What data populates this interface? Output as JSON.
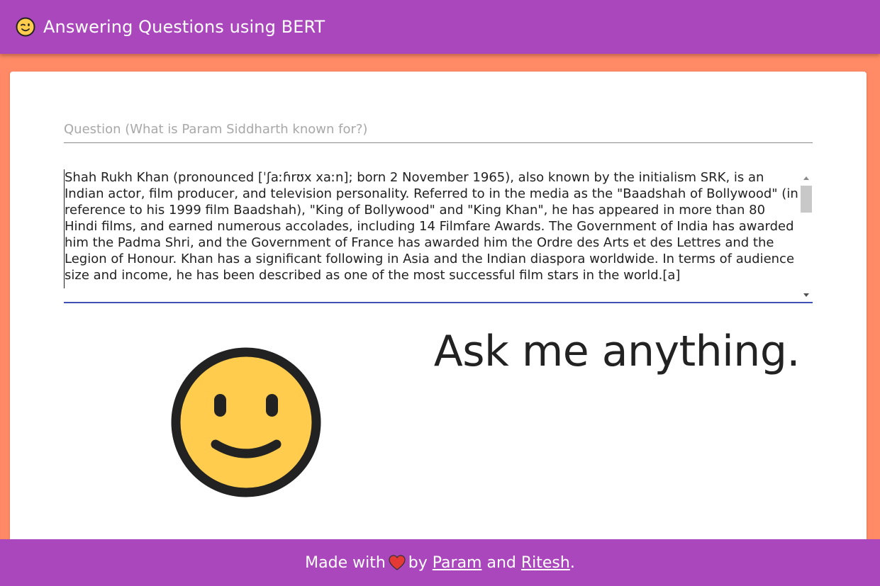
{
  "header": {
    "emoji_icon": "winking-face-icon",
    "title": "Answering Questions using BERT"
  },
  "question": {
    "placeholder": "Question (What is Param Siddharth known for?)",
    "value": ""
  },
  "context": {
    "value": "Shah Rukh Khan (pronounced [ˈʃaːɦrʊx xaːn]; born 2 November 1965), also known by the initialism SRK, is an Indian actor, film producer, and television personality. Referred to in the media as the \"Baadshah of Bollywood\" (in reference to his 1999 film Baadshah), \"King of Bollywood\" and \"King Khan\", he has appeared in more than 80 Hindi films, and earned numerous accolades, including 14 Filmfare Awards. The Government of India has awarded him the Padma Shri, and the Government of France has awarded him the Ordre des Arts et des Lettres and the Legion of Honour. Khan has a significant following in Asia and the Indian diaspora worldwide. In terms of audience size and income, he has been described as one of the most successful film stars in the world.[a]"
  },
  "main": {
    "face_icon": "smiling-face-icon",
    "prompt": "Ask me anything."
  },
  "footer": {
    "made_with": "Made with",
    "heart_icon": "heart-icon",
    "by": "by",
    "author1": "Param",
    "and": "and",
    "author2": "Ritesh",
    "period": "."
  },
  "colors": {
    "app_bar": "#ab47bc",
    "background": "#ff8a65",
    "focus_underline": "#3f51b5",
    "face_fill": "#ffcc4d",
    "heart": "#e53935"
  }
}
